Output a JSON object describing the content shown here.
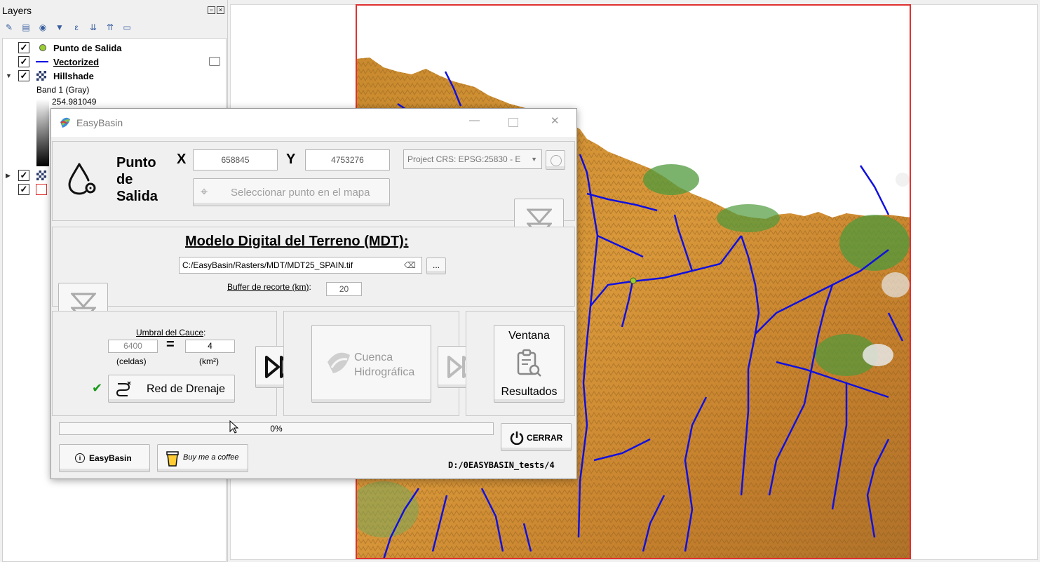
{
  "layers_panel": {
    "title": "Layers",
    "items": [
      {
        "name": "Punto de Salida",
        "checked": "✓"
      },
      {
        "name": "Vectorized",
        "checked": "✓"
      },
      {
        "name": "Hillshade",
        "checked": "✓",
        "band": "Band 1 (Gray)",
        "max_value": "254.981049"
      }
    ]
  },
  "dialog": {
    "title": "EasyBasin",
    "punto": {
      "label_line1": "Punto",
      "label_line2": "de",
      "label_line3": "Salida",
      "x_label": "X",
      "x_value": "658845",
      "y_label": "Y",
      "y_value": "4753276",
      "crs": "Project CRS: EPSG:25830 - E",
      "select_button": "Seleccionar punto en el mapa"
    },
    "mdt": {
      "title": "Modelo Digital del Terreno (MDT):",
      "path": "C:/EasyBasin/Rasters/MDT/MDT25_SPAIN.tif",
      "browse": "...",
      "buffer_label": "Buffer de recorte (km)",
      "buffer_colon": ":",
      "buffer_value": "20"
    },
    "drenaje": {
      "umbral_label": "Umbral del Cauce",
      "umbral_colon": ":",
      "cells_value": "6400",
      "equals": "=",
      "km2_value": "4",
      "cells_unit": "(celdas)",
      "km2_unit": "(km²)",
      "check": "✔",
      "button": "Red de Drenaje"
    },
    "cuenca": {
      "line1": "Cuenca",
      "line2": "Hidrográfica"
    },
    "resultados": {
      "line1": "Ventana",
      "line2": "Resultados"
    },
    "progress": {
      "text": "0%",
      "value": 0
    },
    "close_button": "CERRAR",
    "info_button": "EasyBasin",
    "coffee_button": "Buy me a coffee",
    "path_label": "D:/0EASYBASIN_tests/4"
  },
  "colors": {
    "accent_red": "#e03030",
    "river_blue": "#1010e0",
    "outlet_point": "#9acd32",
    "check_green": "#1a9a1a"
  }
}
